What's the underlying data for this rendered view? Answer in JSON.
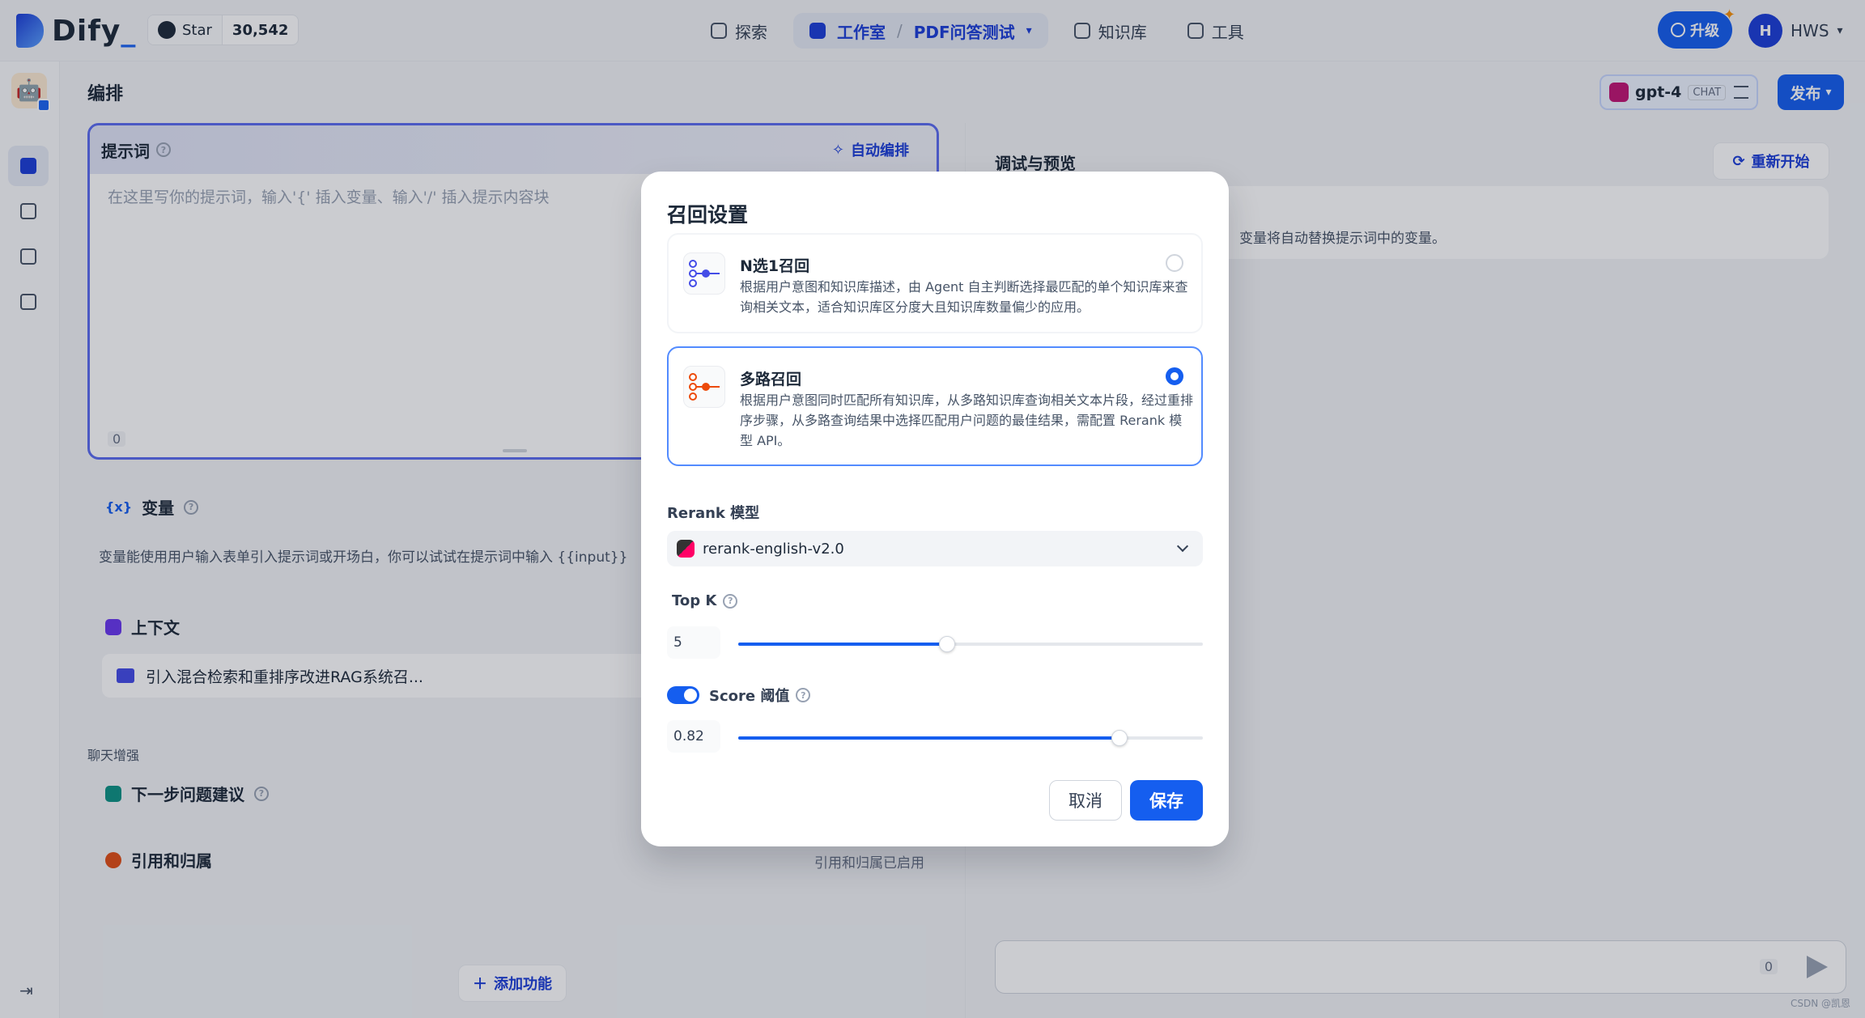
{
  "header": {
    "brand": "Dify",
    "github": {
      "label": "Star",
      "count": "30,542"
    },
    "nav": [
      {
        "label": "探索"
      },
      {
        "label": "工作室",
        "app": "PDF问答测试",
        "separator": "/"
      },
      {
        "label": "知识库"
      },
      {
        "label": "工具"
      }
    ],
    "upgrade_label": "升级",
    "user": {
      "initial": "H",
      "name": "HWS"
    }
  },
  "toolbar": {
    "title": "编排",
    "model": {
      "name": "gpt-4",
      "mode": "CHAT"
    },
    "publish_label": "发布"
  },
  "prompt": {
    "title": "提示词",
    "auto_label": "自动编排",
    "placeholder": "在这里写你的提示词，输入'{' 插入变量、输入'/' 插入提示内容块",
    "char_count": "0"
  },
  "variables": {
    "title": "变量",
    "description": "变量能使用用户输入表单引入提示词或开场白，你可以试试在提示词中输入 {{input}}"
  },
  "context": {
    "title": "上下文",
    "item": "引入混合检索和重排序改进RAG系统召..."
  },
  "chat_enhance": {
    "section_label": "聊天增强",
    "suggest_title": "下一步问题建议",
    "citation_title": "引用和归属",
    "citation_status": "引用和归属已启用"
  },
  "add_feature_label": "添加功能",
  "debug": {
    "title": "调试与预览",
    "restart_label": "重新开始",
    "var_hint": "变量将自动替换提示词中的变量。",
    "input_count": "0"
  },
  "watermark": "CSDN @凯恩",
  "modal": {
    "title": "召回设置",
    "options": [
      {
        "title": "N选1召回",
        "description": "根据用户意图和知识库描述，由 Agent 自主判断选择最匹配的单个知识库来查询相关文本，适合知识库区分度大且知识库数量偏少的应用。",
        "selected": false,
        "color": "#444ce7"
      },
      {
        "title": "多路召回",
        "description": "根据用户意图同时匹配所有知识库，从多路知识库查询相关文本片段，经过重排序步骤，从多路查询结果中选择匹配用户问题的最佳结果，需配置 Rerank 模型 API。",
        "selected": true,
        "color": "#ec4a0a"
      }
    ],
    "rerank_label": "Rerank 模型",
    "rerank_model": "rerank-english-v2.0",
    "topk": {
      "label": "Top K",
      "value": "5",
      "fraction": 0.45
    },
    "score": {
      "label": "Score 阈值",
      "value": "0.82",
      "fraction": 0.82,
      "enabled": true
    },
    "cancel_label": "取消",
    "save_label": "保存"
  },
  "colors": {
    "primary": "#155eef",
    "accent_border": "#528bff"
  }
}
